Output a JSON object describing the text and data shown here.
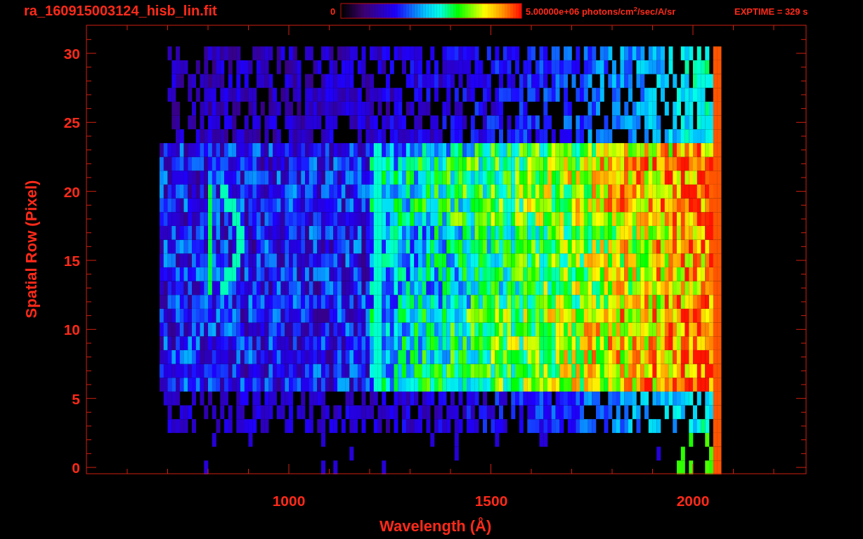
{
  "plot": {
    "title": "ra_160915003124_hisb_lin.fit",
    "colorbar": {
      "min_label": "0",
      "max_label": "5.00000e+06 photons/cm$^{2}$/sec/A/sr"
    },
    "exposure": "EXPTIME = 329 s",
    "x_axis": {
      "label": "Wavelength (Å)",
      "ticks": [
        "1000",
        "1500",
        "2000"
      ]
    },
    "y_axis": {
      "label": "Spatial Row (Pixel)",
      "ticks": [
        "30",
        "25",
        "20",
        "15",
        "10",
        "5",
        "0"
      ]
    }
  }
}
